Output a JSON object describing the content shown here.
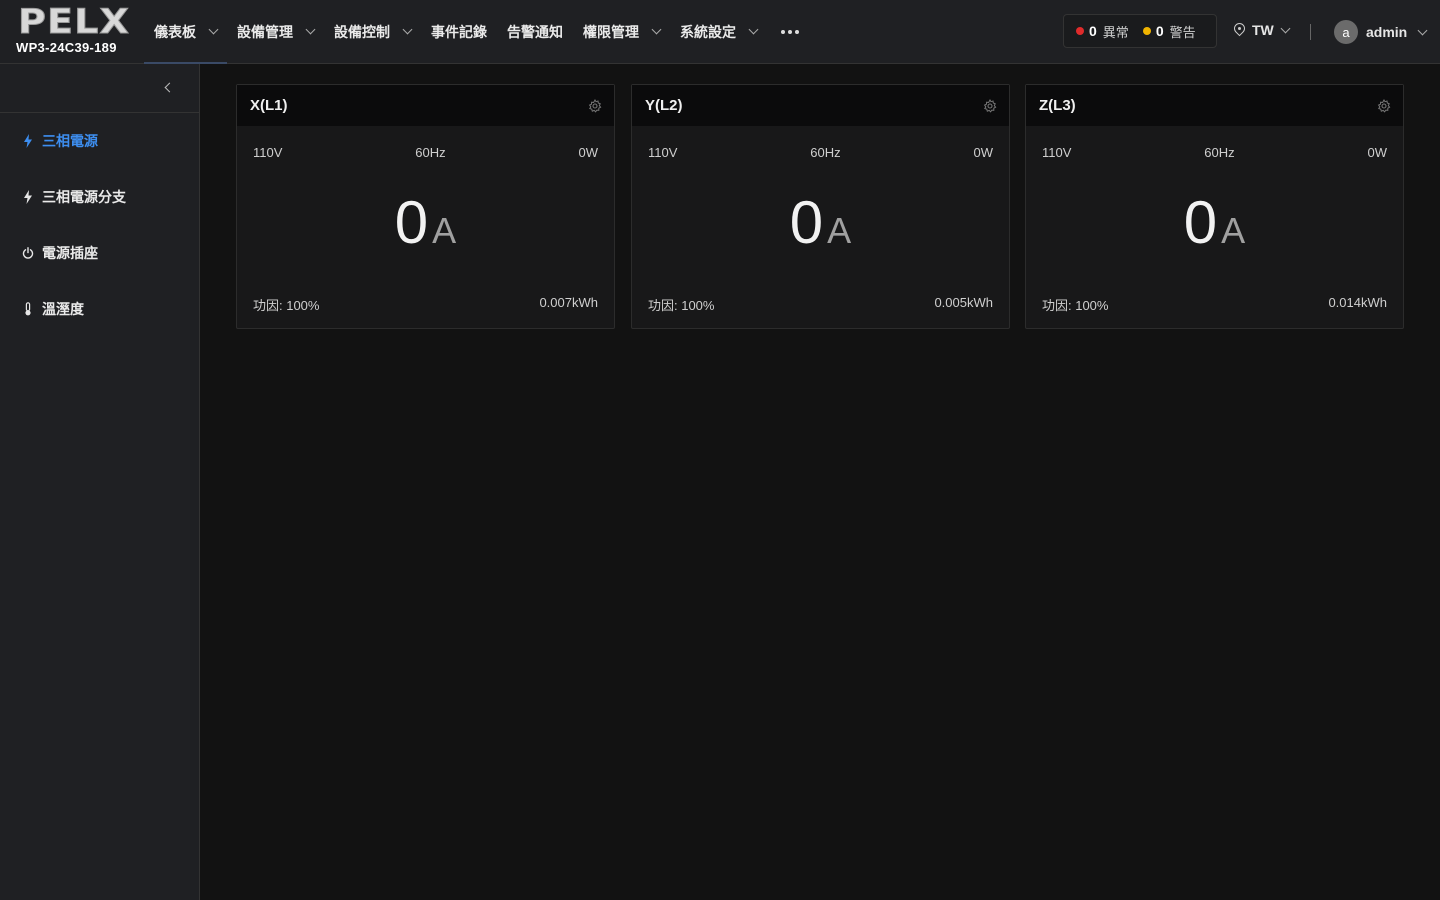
{
  "brand": {
    "logo": "PELX",
    "model": "WP3-24C39-189"
  },
  "nav": {
    "items": [
      {
        "label": "儀表板",
        "dropdown": true,
        "active": true
      },
      {
        "label": "設備管理",
        "dropdown": true
      },
      {
        "label": "設備控制",
        "dropdown": true
      },
      {
        "label": "事件記錄",
        "dropdown": false
      },
      {
        "label": "告警通知",
        "dropdown": false
      },
      {
        "label": "權限管理",
        "dropdown": true
      },
      {
        "label": "系統設定",
        "dropdown": true
      }
    ]
  },
  "alerts": {
    "abnormal_count": "0",
    "abnormal_label": "異常",
    "abnormal_color": "#e02b2b",
    "warning_count": "0",
    "warning_label": "警告",
    "warning_color": "#f0b400"
  },
  "region": {
    "label": "TW"
  },
  "user": {
    "initial": "a",
    "name": "admin"
  },
  "sidebar": {
    "items": [
      {
        "label": "三相電源",
        "icon": "bolt-icon",
        "active": true
      },
      {
        "label": "三相電源分支",
        "icon": "bolt-icon"
      },
      {
        "label": "電源插座",
        "icon": "power-icon"
      },
      {
        "label": "溫溼度",
        "icon": "thermometer-icon"
      }
    ]
  },
  "cards": [
    {
      "title": "X(L1)",
      "voltage": "110V",
      "frequency": "60Hz",
      "power": "0W",
      "current": "0",
      "unit": "A",
      "pf": "功因: 100%",
      "energy": "0.007kWh"
    },
    {
      "title": "Y(L2)",
      "voltage": "110V",
      "frequency": "60Hz",
      "power": "0W",
      "current": "0",
      "unit": "A",
      "pf": "功因: 100%",
      "energy": "0.005kWh"
    },
    {
      "title": "Z(L3)",
      "voltage": "110V",
      "frequency": "60Hz",
      "power": "0W",
      "current": "0",
      "unit": "A",
      "pf": "功因: 100%",
      "energy": "0.014kWh"
    }
  ],
  "colors": {
    "accent": "#3d8ef0",
    "background": "#121212",
    "panel": "#1f2023"
  }
}
